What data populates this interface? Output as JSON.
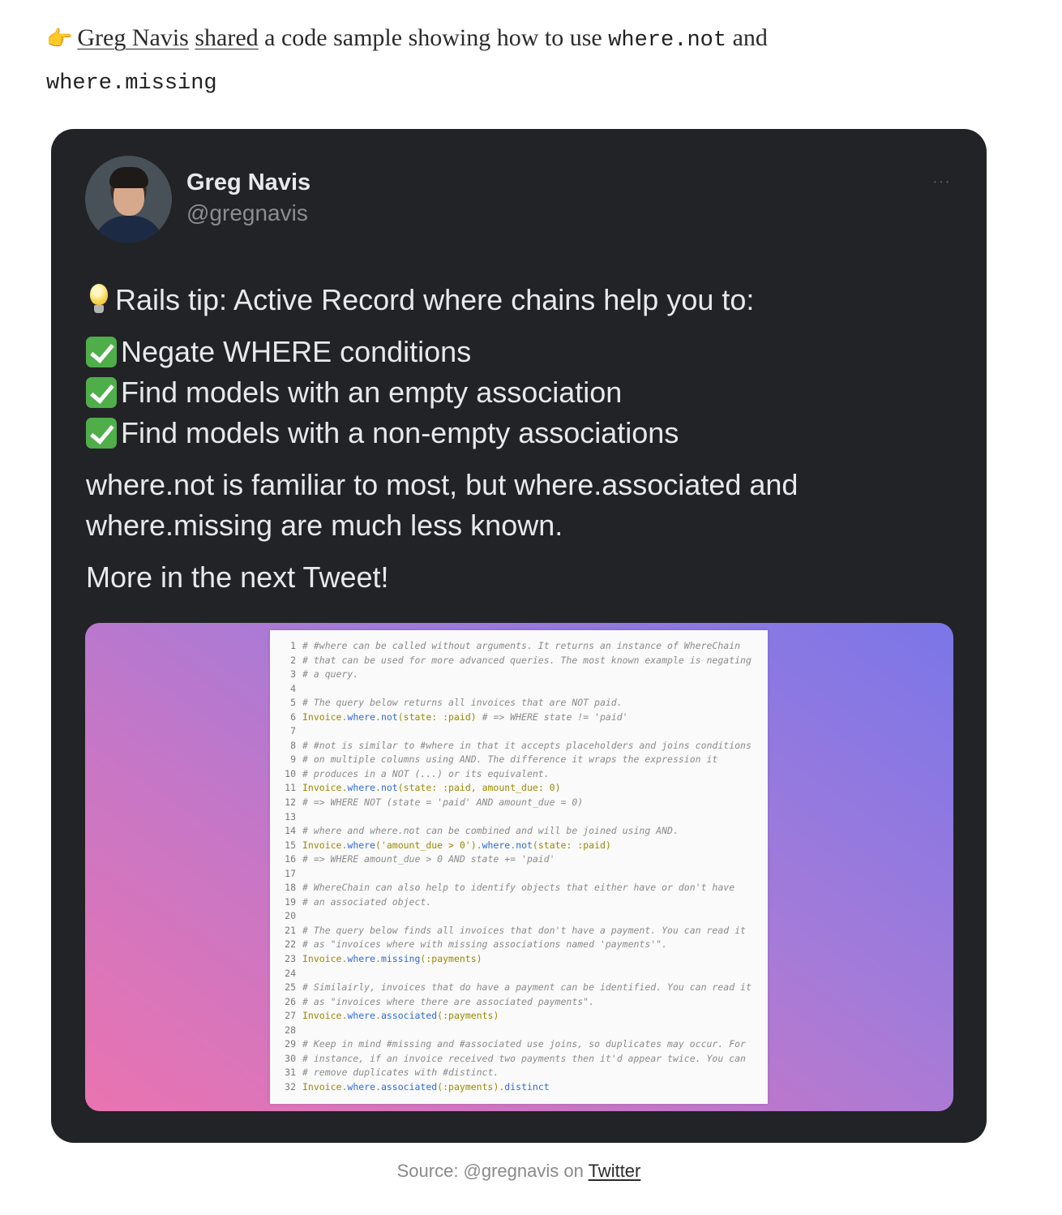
{
  "intro": {
    "pointer_icon": "backhand-index-pointing-right",
    "author_link": "Greg Navis",
    "shared_link": "shared",
    "text_before_code": "a code sample showing how to use",
    "code_1": "where.not",
    "text_and": "and",
    "code_2": "where.missing"
  },
  "tweet": {
    "author_name": "Greg Navis",
    "author_handle": "@gregnavis",
    "more_label": "···",
    "tip": "Rails tip: Active Record where chains help you to:",
    "checklist": [
      "Negate WHERE conditions",
      "Find models with an empty association",
      "Find models with a non-empty associations"
    ],
    "paragraph_line_1": "where.not is familiar to most, but where.associated and",
    "paragraph_line_2": "where.missing are much less known.",
    "closing": "More in the next Tweet!",
    "colors": {
      "card_background": "#222326",
      "text": "#e7e9ea",
      "handle": "#8a8d91"
    }
  },
  "code_image": {
    "lines": [
      {
        "n": "1",
        "text": "# #where can be called without arguments. It returns an instance of WhereChain"
      },
      {
        "n": "2",
        "text": "# that can be used for more advanced queries. The most known example is negating"
      },
      {
        "n": "3",
        "text": "# a query."
      },
      {
        "n": "4",
        "text": ""
      },
      {
        "n": "5",
        "text": "# The query below returns all invoices that are NOT paid."
      },
      {
        "n": "6",
        "text": "Invoice.where.not(state: :paid) # => WHERE state != 'paid'"
      },
      {
        "n": "7",
        "text": ""
      },
      {
        "n": "8",
        "text": "# #not is similar to #where in that it accepts placeholders and joins conditions"
      },
      {
        "n": "9",
        "text": "# on multiple columns using AND. The difference it wraps the expression it"
      },
      {
        "n": "10",
        "text": "# produces in a NOT (...) or its equivalent."
      },
      {
        "n": "11",
        "text": "Invoice.where.not(state: :paid, amount_due: 0)"
      },
      {
        "n": "12",
        "text": "# => WHERE NOT (state = 'paid' AND amount_due = 0)"
      },
      {
        "n": "13",
        "text": ""
      },
      {
        "n": "14",
        "text": "# where and where.not can be combined and will be joined using AND."
      },
      {
        "n": "15",
        "text": "Invoice.where('amount_due > 0').where.not(state: :paid)"
      },
      {
        "n": "16",
        "text": "# => WHERE amount_due > 0 AND state += 'paid'"
      },
      {
        "n": "17",
        "text": ""
      },
      {
        "n": "18",
        "text": "# WhereChain can also help to identify objects that either have or don't have"
      },
      {
        "n": "19",
        "text": "# an associated object."
      },
      {
        "n": "20",
        "text": ""
      },
      {
        "n": "21",
        "text": "# The query below finds all invoices that don't have a payment. You can read it"
      },
      {
        "n": "22",
        "text": "# as \"invoices where with missing associations named 'payments'\"."
      },
      {
        "n": "23",
        "text": "Invoice.where.missing(:payments)"
      },
      {
        "n": "24",
        "text": ""
      },
      {
        "n": "25",
        "text": "# Similairly, invoices that do have a payment can be identified. You can read it"
      },
      {
        "n": "26",
        "text": "# as \"invoices where there are associated payments\"."
      },
      {
        "n": "27",
        "text": "Invoice.where.associated(:payments)"
      },
      {
        "n": "28",
        "text": ""
      },
      {
        "n": "29",
        "text": "# Keep in mind #missing and #associated use joins, so duplicates may occur. For"
      },
      {
        "n": "30",
        "text": "# instance, if an invoice received two payments then it'd appear twice. You can"
      },
      {
        "n": "31",
        "text": "# remove duplicates with #distinct."
      },
      {
        "n": "32",
        "text": "Invoice.where.associated(:payments).distinct"
      }
    ]
  },
  "caption": {
    "prefix": "Source: @gregnavis on",
    "link": "Twitter"
  }
}
